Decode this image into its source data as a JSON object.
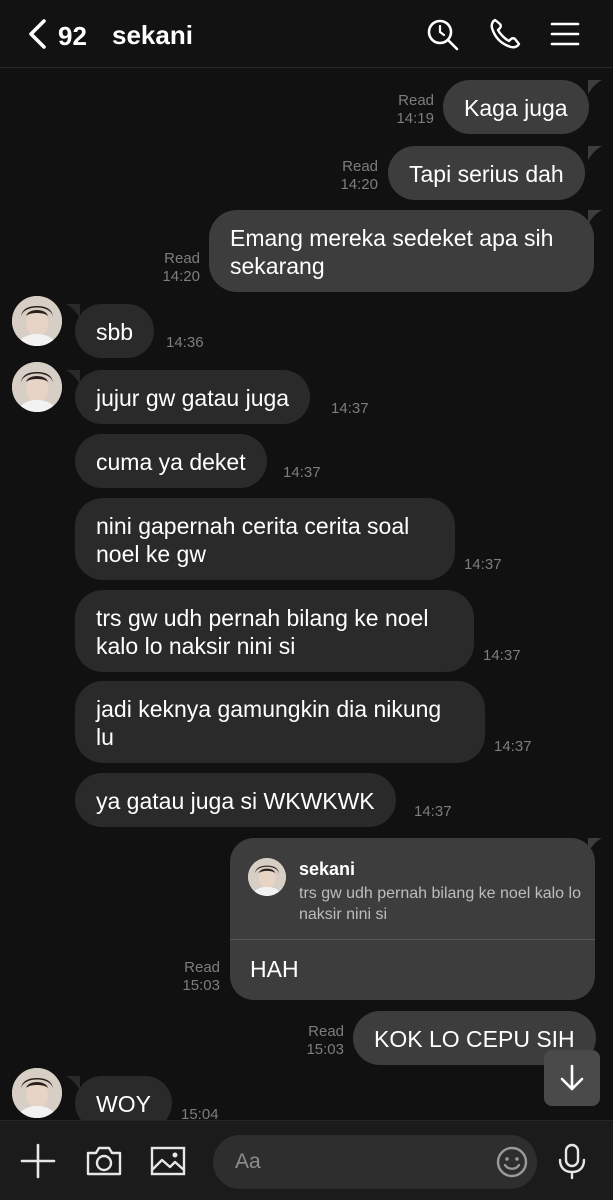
{
  "header": {
    "back_count": "92",
    "title": "sekani",
    "icons": [
      "search-icon",
      "phone-icon",
      "menu-icon"
    ]
  },
  "messages": [
    {
      "dir": "out",
      "text": "Kaga juga",
      "status": "Read",
      "time": "14:19"
    },
    {
      "dir": "out",
      "text": "Tapi serius dah",
      "status": "Read",
      "time": "14:20"
    },
    {
      "dir": "out",
      "text": "Emang mereka sedeket apa sih\nsekarang",
      "status": "Read",
      "time": "14:20"
    },
    {
      "dir": "in",
      "text": "sbb",
      "time": "14:36"
    },
    {
      "dir": "in",
      "text": "jujur gw gatau juga",
      "time": "14:37"
    },
    {
      "dir": "in",
      "text": "cuma ya deket",
      "time": "14:37"
    },
    {
      "dir": "in",
      "text": "nini gapernah cerita cerita soal\nnoel ke gw",
      "time": "14:37"
    },
    {
      "dir": "in",
      "text": "trs gw udh pernah bilang ke noel\nkalo lo naksir nini si",
      "time": "14:37"
    },
    {
      "dir": "in",
      "text": "jadi keknya gamungkin dia nikung\nlu",
      "time": "14:37"
    },
    {
      "dir": "in",
      "text": "ya gatau juga si WKWKWK",
      "time": "14:37"
    },
    {
      "dir": "out",
      "reply_to_name": "sekani",
      "reply_to_text": "trs gw udh pernah bilang ke noel kalo lo naksir nini si",
      "text": "HAH",
      "status": "Read",
      "time": "15:03"
    },
    {
      "dir": "out",
      "text": "KOK LO CEPU SIH",
      "status": "Read",
      "time": "15:03"
    },
    {
      "dir": "in",
      "text": "WOY",
      "time": "15:04"
    }
  ],
  "composer": {
    "placeholder": "Aa",
    "icons": [
      "plus-icon",
      "camera-icon",
      "image-icon",
      "emoji-icon",
      "microphone-icon"
    ]
  },
  "scroll_down_icon": "arrow-down-icon",
  "colors": {
    "background": "#111111",
    "bubble_out": "#3d3d3d",
    "bubble_in": "#2a2a2a",
    "meta_text": "#7d7d7d"
  }
}
